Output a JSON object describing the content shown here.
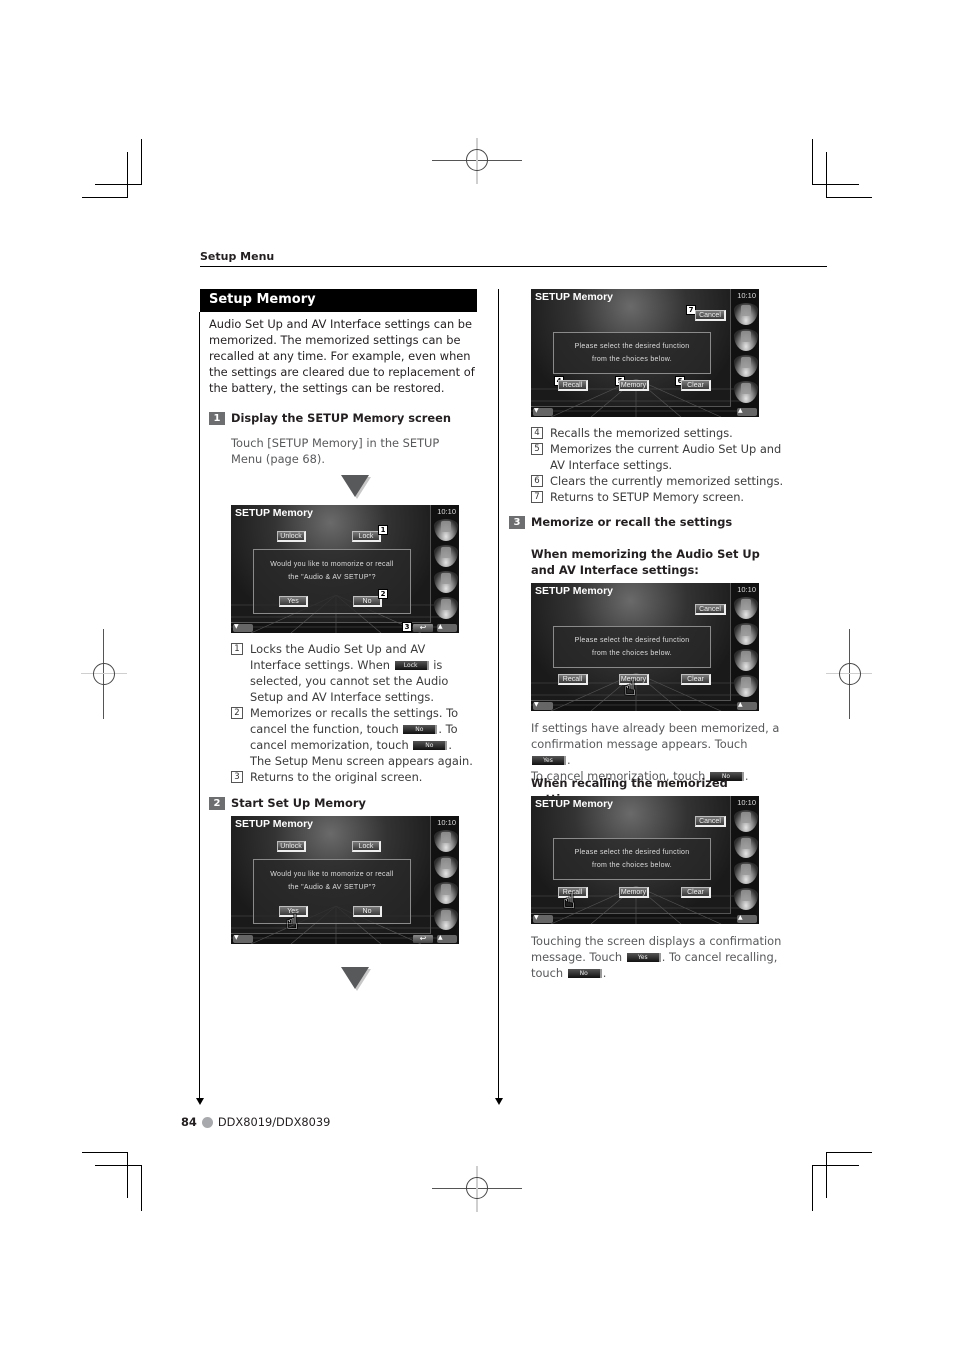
{
  "header": {
    "section": "Setup Menu"
  },
  "title": "Setup Memory",
  "intro": "Audio Set Up and AV Interface settings can be memorized. The memorized settings can be recalled at any time. For example, even when the settings are cleared due to replacement of the battery, the settings can be restored.",
  "steps": [
    {
      "num": "1",
      "label": "Display the SETUP Memory screen",
      "text": "Touch [SETUP Memory] in the SETUP Menu (page 68)."
    },
    {
      "num": "2",
      "label": "Start Set Up Memory"
    },
    {
      "num": "3",
      "label": "Memorize or recall the settings"
    }
  ],
  "screen_common": {
    "title": "SETUP Memory",
    "time": "10:10",
    "side_icons": [
      "dvd-disc-icon",
      "tv-icon",
      "speaker-icon",
      "tools-icon"
    ],
    "return_glyph": "↩"
  },
  "screen1": {
    "buttons": {
      "unlock": "Unlock",
      "lock": "Lock",
      "yes": "Yes",
      "no": "No"
    },
    "message": [
      "Would you like to momorize or recall",
      "the \"Audio & AV SETUP\"?"
    ],
    "callouts": [
      "1",
      "2",
      "3"
    ]
  },
  "list1": [
    {
      "num": "1",
      "parts": [
        "Locks the Audio Set Up and AV Interface settings. When ",
        " is selected, you cannot set the Audio Setup and AV Interface settings."
      ],
      "btn": "Lock"
    },
    {
      "num": "2",
      "parts": [
        "Memorizes or recalls the settings. To cancel the function, touch ",
        ". To cancel memorization, touch ",
        ".",
        "The Setup Menu screen appears again."
      ],
      "btn": "No"
    },
    {
      "num": "3",
      "text": "Returns to the original screen."
    }
  ],
  "screen2": {
    "buttons": {
      "unlock": "Unlock",
      "lock": "Lock",
      "yes": "Yes",
      "no": "No"
    },
    "message": [
      "Would you like to momorize or recall",
      "the \"Audio & AV SETUP\"?"
    ]
  },
  "screen3": {
    "buttons": {
      "cancel": "Cancel",
      "recall": "Recall",
      "memory": "Memory",
      "clear": "Clear"
    },
    "message": [
      "Please select the desired function",
      "from the choices below."
    ],
    "callouts": [
      "4",
      "5",
      "6",
      "7"
    ]
  },
  "list2": [
    {
      "num": "4",
      "text": "Recalls the memorized settings."
    },
    {
      "num": "5",
      "text": "Memorizes the current Audio Set Up and AV Interface settings."
    },
    {
      "num": "6",
      "text": "Clears the currently memorized settings."
    },
    {
      "num": "7",
      "text": "Returns to SETUP Memory screen."
    }
  ],
  "memorize": {
    "heading": "When memorizing the Audio Set Up and AV Interface settings:",
    "text": [
      "If settings have already been memorized, a confirmation message appears. Touch ",
      ".",
      "To cancel memorization, touch ",
      "."
    ],
    "btn_yes": "Yes",
    "btn_no": "No"
  },
  "recall": {
    "heading": "When recalling the memorized settings:",
    "text": [
      "Touching the screen displays a confirmation message. Touch ",
      ". To cancel recalling, touch ",
      "."
    ],
    "btn_yes": "Yes",
    "btn_no": "No"
  },
  "footer": {
    "page": "84",
    "model": "DDX8019/DDX8039"
  }
}
